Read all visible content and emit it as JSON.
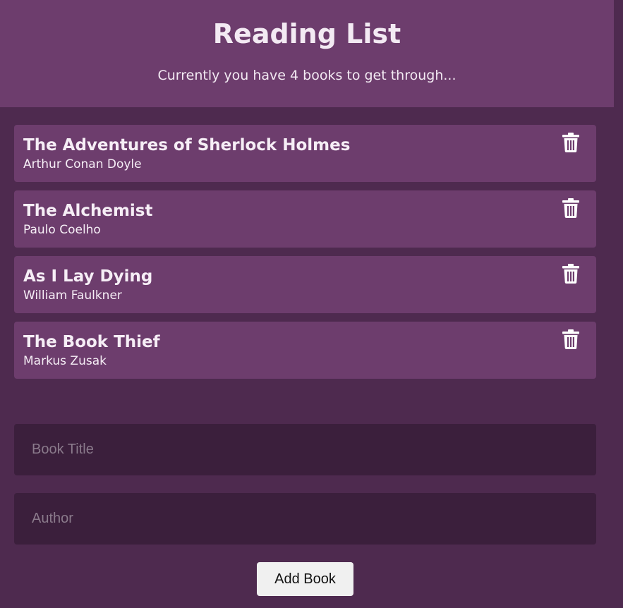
{
  "header": {
    "title": "Reading List",
    "subtitle": "Currently you have 4 books to get through..."
  },
  "books": [
    {
      "title": "The Adventures of Sherlock Holmes",
      "author": "Arthur Conan Doyle",
      "delete_icon": "trash-icon"
    },
    {
      "title": "The Alchemist",
      "author": "Paulo Coelho",
      "delete_icon": "trash-icon"
    },
    {
      "title": "As I Lay Dying",
      "author": "William Faulkner",
      "delete_icon": "trash-icon"
    },
    {
      "title": "The Book Thief",
      "author": "Markus Zusak",
      "delete_icon": "trash-icon"
    }
  ],
  "form": {
    "title_value": "",
    "title_placeholder": "Book Title",
    "author_value": "",
    "author_placeholder": "Author",
    "submit_label": "Add Book"
  },
  "colors": {
    "background": "#4e2a4f",
    "card": "#6d3d6d",
    "input": "#3b1f3c",
    "button": "#f0f0f0"
  }
}
